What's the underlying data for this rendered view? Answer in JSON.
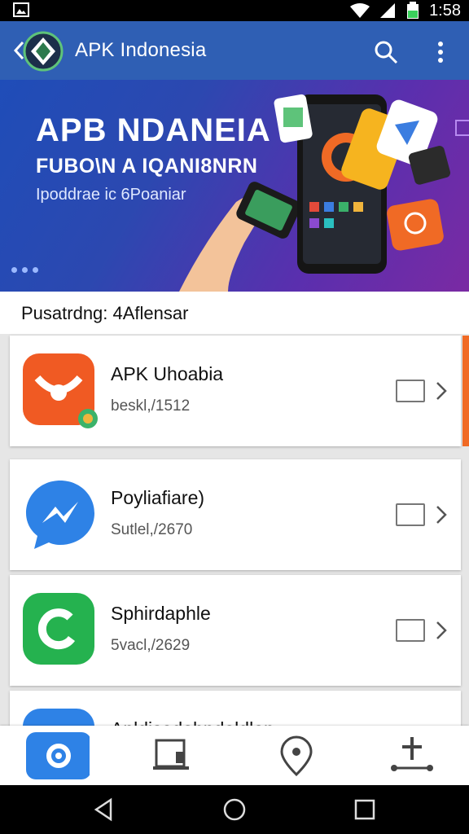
{
  "status_bar": {
    "time": "1:58"
  },
  "app_bar": {
    "title": "APK Indonesia"
  },
  "banner": {
    "headline": "APB NDANEIA",
    "subheadline": "FUBO\\N A IQANI8NRN",
    "tagline": "Ipoddrae ic 6Poaniar"
  },
  "section": {
    "label": "Pusatrdng: 4Aflensar"
  },
  "apps": [
    {
      "name": "APK Uhoabia",
      "meta": "beskl,/1512"
    },
    {
      "name": "Poyliafiare)",
      "meta": "Sutlel,/2670"
    },
    {
      "name": "Sphirdaphle",
      "meta": "5vacl,/2629"
    },
    {
      "name": "Apldisadohndoldlon",
      "meta": ""
    }
  ],
  "colors": {
    "app_bar": "#2f5fb4",
    "accent": "#f06a25"
  }
}
